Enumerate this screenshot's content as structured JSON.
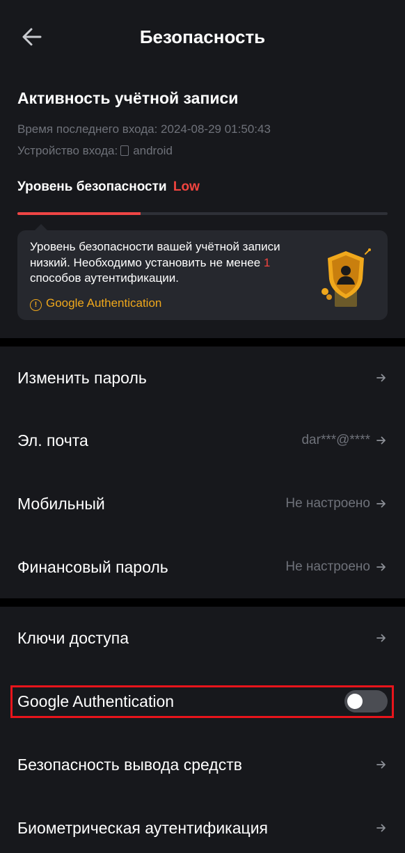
{
  "header": {
    "title": "Безопасность",
    "back_icon": "arrow-left-icon"
  },
  "account_activity": {
    "title": "Активность учётной записи",
    "last_login_label": "Время последнего входа:",
    "last_login_value": "2024-08-29 01:50:43",
    "device_label": "Устройство входа:",
    "device_icon": "phone-icon",
    "device_value": "android"
  },
  "security_level": {
    "label": "Уровень безопасности",
    "value": "Low",
    "value_color": "#f1443f",
    "progress": 0.333,
    "notice": {
      "text_before": "Уровень безопасности вашей учётной записи низкий. Необходимо установить не менее ",
      "count": "1",
      "text_after": " способов аутентификации.",
      "link_icon": "warning-circle-icon",
      "link_label": "Google Authentication",
      "illustration": "shield-user-icon"
    }
  },
  "group1": [
    {
      "label": "Изменить пароль",
      "value": ""
    },
    {
      "label": "Эл. почта",
      "value": "dar***@****"
    },
    {
      "label": "Мобильный",
      "value": "Не настроено"
    },
    {
      "label": "Финансовый пароль",
      "value": "Не настроено"
    }
  ],
  "group2": {
    "passkeys": {
      "label": "Ключи доступа"
    },
    "google_auth": {
      "label": "Google Authentication",
      "enabled": false
    },
    "withdrawal_security": {
      "label": "Безопасность вывода средств"
    },
    "biometric": {
      "label": "Биометрическая аутентификация"
    }
  },
  "colors": {
    "background": "#17181c",
    "danger": "#f1443f",
    "warning": "#f0a81c",
    "muted_text": "#6f727a",
    "highlight": "#e8141b"
  }
}
